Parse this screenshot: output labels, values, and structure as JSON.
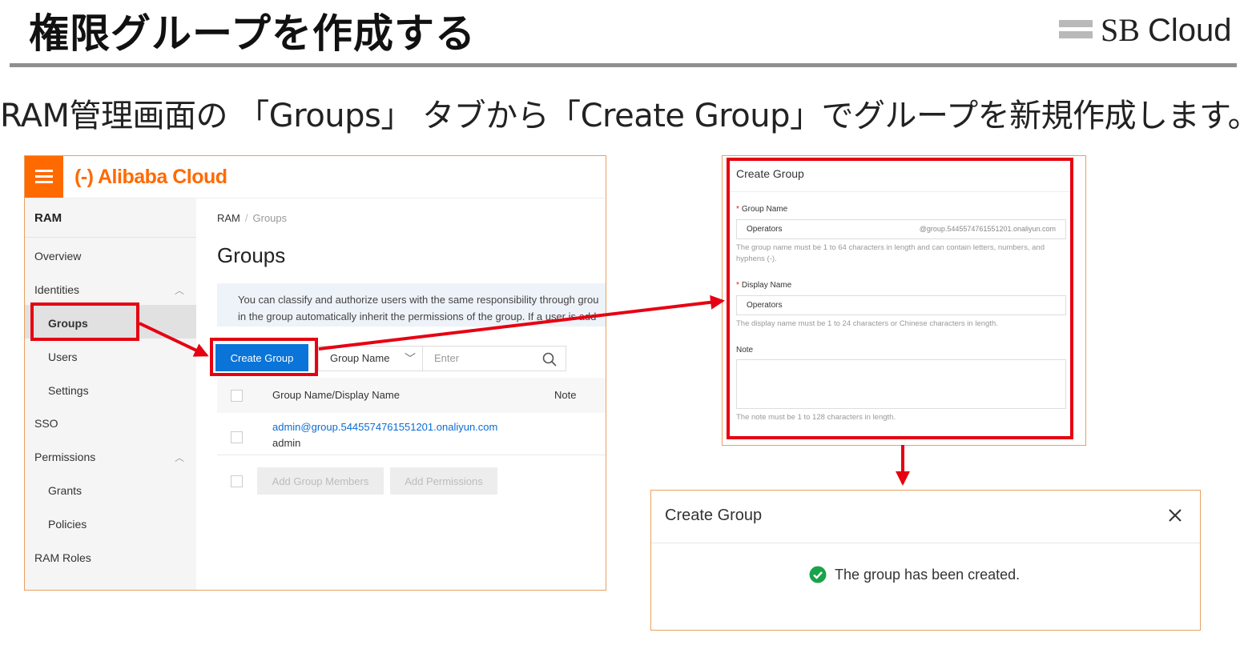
{
  "slide": {
    "title": "権限グループを作成する",
    "brand": {
      "sb": "SB",
      "cloud": "Cloud"
    },
    "subtitle": "RAM管理画面の 「Groups」 タブから「Create Group」でグループを新規作成します。"
  },
  "console": {
    "logo": "(-) Alibaba Cloud",
    "sidebar": {
      "title": "RAM",
      "items": [
        {
          "label": "Overview"
        },
        {
          "label": "Identities"
        },
        {
          "label": "Groups"
        },
        {
          "label": "Users"
        },
        {
          "label": "Settings"
        },
        {
          "label": "SSO"
        },
        {
          "label": "Permissions"
        },
        {
          "label": "Grants"
        },
        {
          "label": "Policies"
        },
        {
          "label": "RAM Roles"
        }
      ]
    },
    "breadcrumb": {
      "root": "RAM",
      "separator": "/",
      "current": "Groups"
    },
    "page_title": "Groups",
    "info": {
      "line1": "You can classify and authorize users with the same responsibility through grou",
      "line2": "in the group automatically inherit the permissions of the group. If a user is add"
    },
    "toolbar": {
      "create_label": "Create Group",
      "filter_label": "Group Name",
      "search_placeholder": "Enter"
    },
    "table": {
      "headers": [
        "Group Name/Display Name",
        "Note"
      ],
      "rows": [
        {
          "group_name": "admin@group.5445574761551201.onaliyun.com",
          "display_name": "admin",
          "note": ""
        }
      ]
    },
    "bulk": {
      "add_members": "Add Group Members",
      "add_permissions": "Add Permissions"
    }
  },
  "create_form": {
    "title": "Create Group",
    "group_name": {
      "label": "Group Name",
      "value": "Operators",
      "suffix": "@group.5445574761551201.onaliyun.com",
      "help": "The group name must be 1 to 64 characters in length and can contain letters, numbers, and hyphens (-)."
    },
    "display_name": {
      "label": "Display Name",
      "value": "Operators",
      "help": "The display name must be 1 to 24 characters or Chinese characters in length."
    },
    "note": {
      "label": "Note",
      "value": "",
      "help": "The note must be 1 to 128 characters in length."
    }
  },
  "result_dialog": {
    "title": "Create Group",
    "message": "The group has been created."
  },
  "colors": {
    "annotation_red": "#e60012",
    "alibaba_orange": "#ff6a00",
    "primary_blue": "#0a74d8",
    "success_green": "#1aa34a"
  },
  "icons": [
    "menu-icon",
    "chevron-up-icon",
    "chevron-down-icon",
    "search-icon",
    "checkbox-icon",
    "close-icon",
    "success-check-icon"
  ]
}
